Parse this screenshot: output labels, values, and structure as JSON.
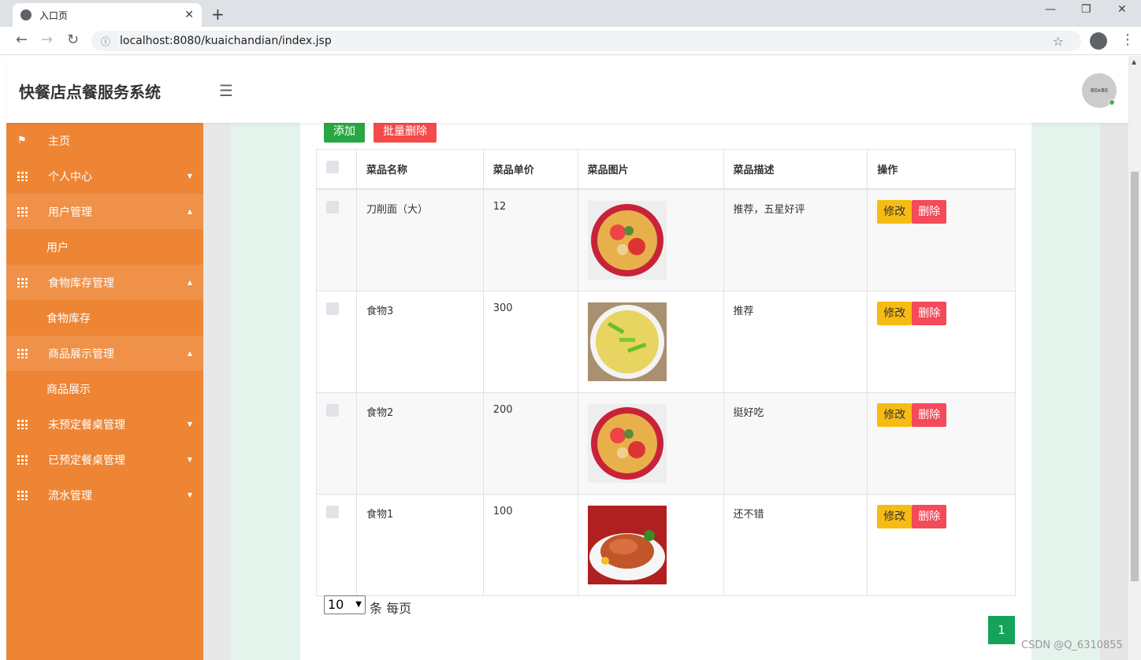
{
  "browser": {
    "tab_title": "入口页",
    "url": "localhost:8080/kuaichandian/index.jsp"
  },
  "header": {
    "brand": "快餐店点餐服务系统",
    "avatar_text": "80x80"
  },
  "sidebar": {
    "items": [
      {
        "label": "主页"
      },
      {
        "label": "个人中心"
      },
      {
        "label": "用户管理"
      },
      {
        "label": "用户"
      },
      {
        "label": "食物库存管理"
      },
      {
        "label": "食物库存"
      },
      {
        "label": "商品展示管理"
      },
      {
        "label": "商品展示"
      },
      {
        "label": "未预定餐桌管理"
      },
      {
        "label": "已预定餐桌管理"
      },
      {
        "label": "流水管理"
      }
    ]
  },
  "toolbar": {
    "add_label": "添加",
    "batch_delete_label": "批量删除"
  },
  "table": {
    "headers": [
      "菜品名称",
      "菜品单价",
      "菜品图片",
      "菜品描述",
      "操作"
    ],
    "edit_label": "修改",
    "delete_label": "删除",
    "rows": [
      {
        "name": "刀削面（大）",
        "price": "12",
        "desc": "推荐，五星好评"
      },
      {
        "name": "食物3",
        "price": "300",
        "desc": "推荐"
      },
      {
        "name": "食物2",
        "price": "200",
        "desc": "挺好吃"
      },
      {
        "name": "食物1",
        "price": "100",
        "desc": "还不错"
      }
    ]
  },
  "pager": {
    "page_size": "10",
    "per_page_text": "条 每页",
    "current_page": "1"
  },
  "watermark": "CSDN @Q_6310855"
}
